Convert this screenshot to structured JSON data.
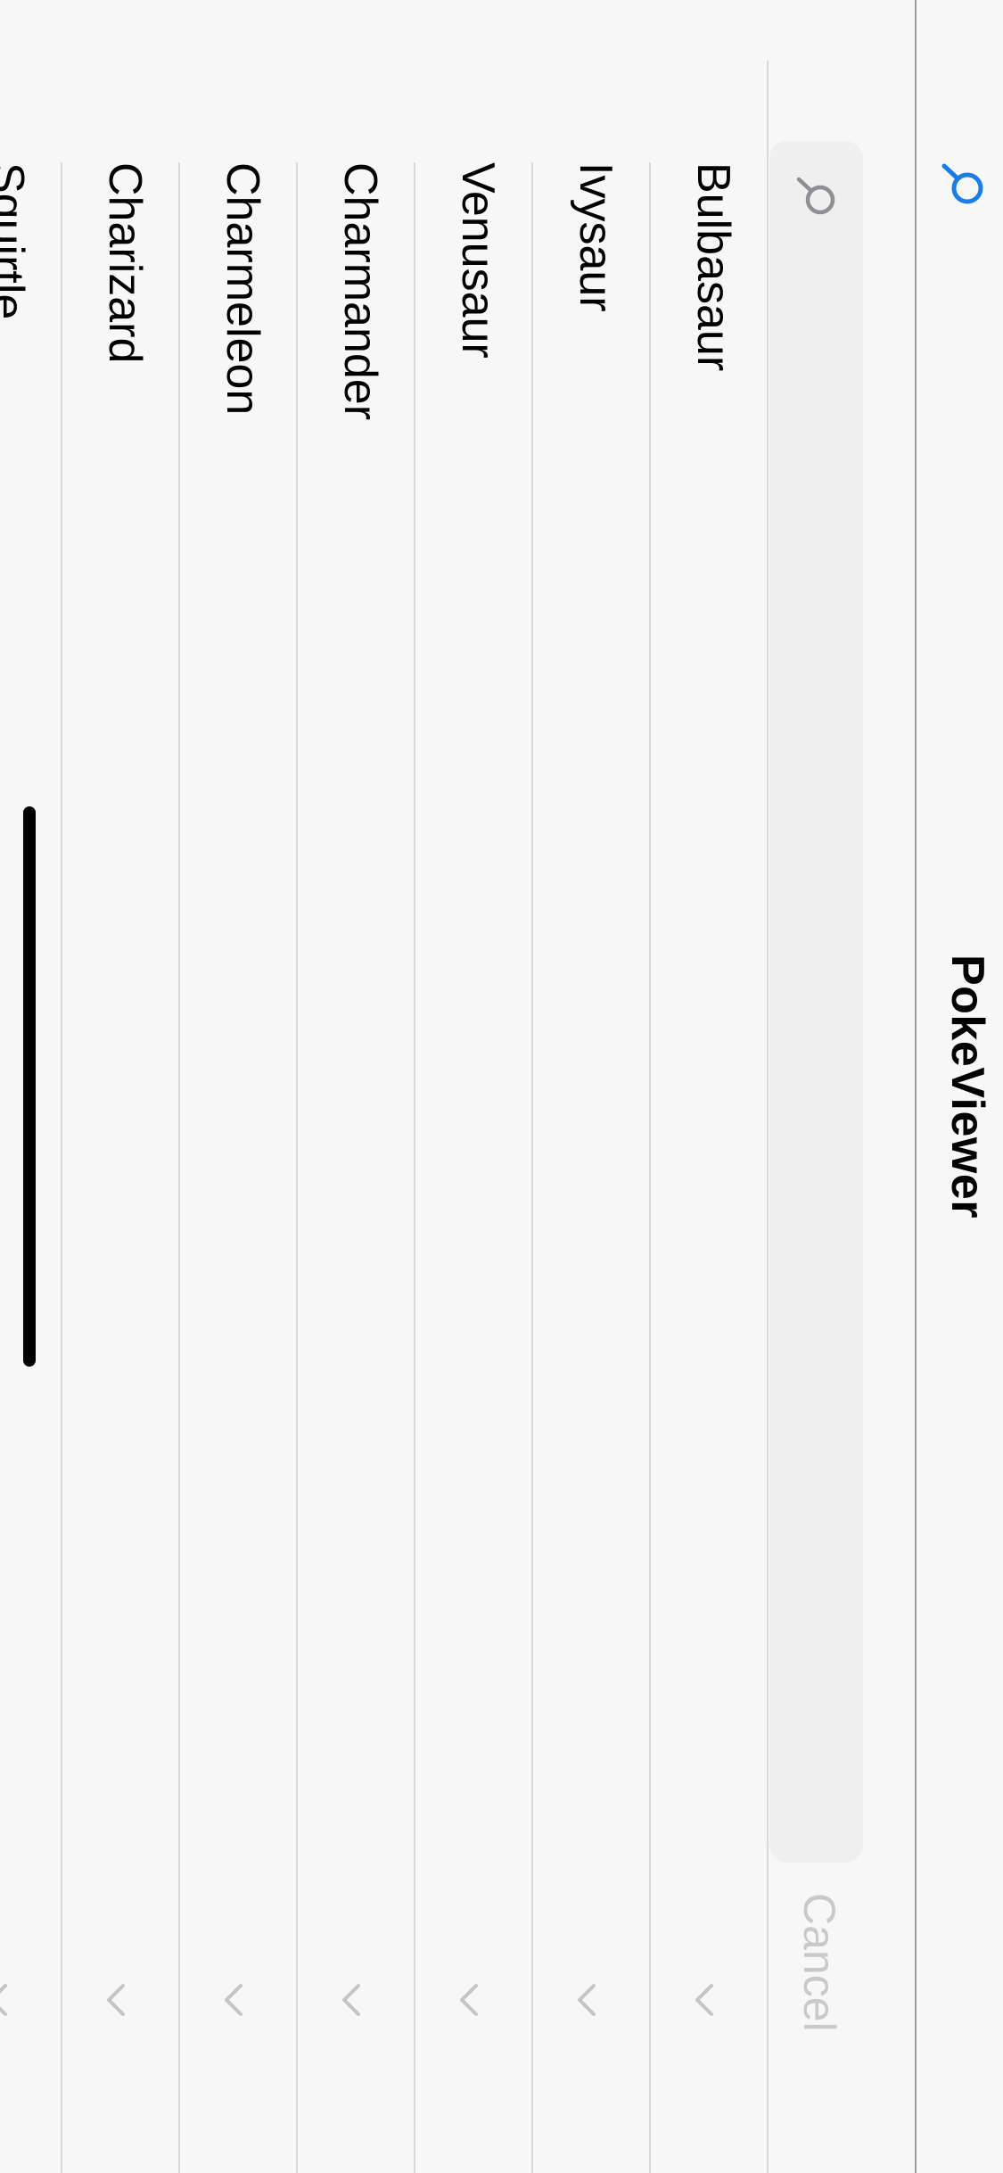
{
  "nav": {
    "title": "PokeViewer",
    "search_icon": "search-icon",
    "accent_color": "#1a7ee8"
  },
  "search": {
    "value": "",
    "placeholder": "",
    "icon": "magnifying-glass-icon",
    "cancel_label": "Cancel"
  },
  "list": {
    "items": [
      {
        "label": "Bulbasaur"
      },
      {
        "label": "Ivysaur"
      },
      {
        "label": "Venusaur"
      },
      {
        "label": "Charmander"
      },
      {
        "label": "Charmeleon"
      },
      {
        "label": "Charizard"
      },
      {
        "label": "Squirtle"
      }
    ],
    "chevron_icon": "chevron-down-icon"
  },
  "colors": {
    "background": "#f7f7f7",
    "search_field": "#efefef",
    "divider": "#d9d9d9",
    "cancel_disabled": "#c9c9c9"
  }
}
